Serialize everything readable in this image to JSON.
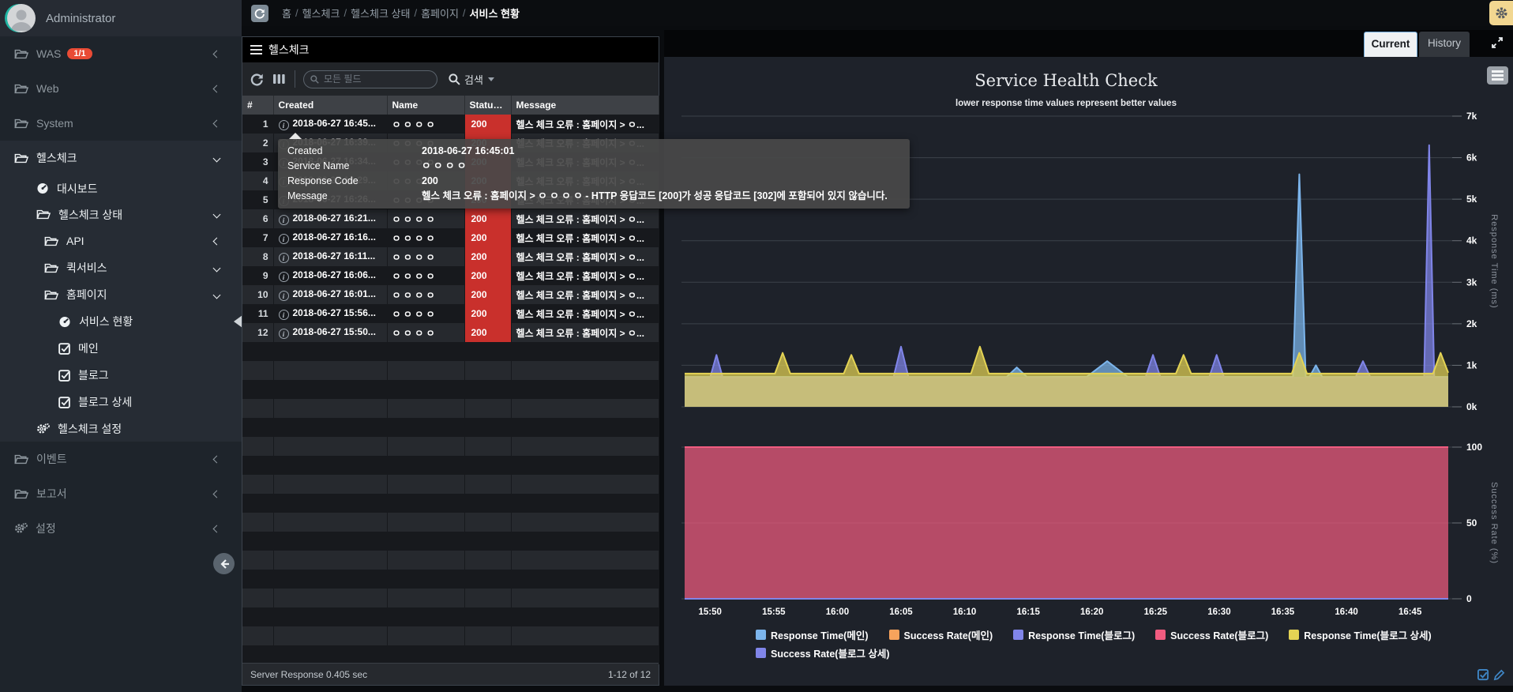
{
  "header": {
    "breadcrumb": {
      "items": [
        "홈",
        "헬스체크",
        "헬스체크 상태",
        "홈페이지"
      ],
      "current": "서비스 현황"
    }
  },
  "sidebar": {
    "user": {
      "name": "Administrator"
    },
    "items": [
      {
        "label": "WAS",
        "icon": "folder",
        "badge": "1/1",
        "chevron": "left",
        "level": 0,
        "bright": false
      },
      {
        "label": "Web",
        "icon": "folder",
        "chevron": "left",
        "level": 0,
        "bright": false
      },
      {
        "label": "System",
        "icon": "folder",
        "chevron": "left",
        "level": 0,
        "bright": false
      },
      {
        "label": "헬스체크",
        "icon": "folder",
        "chevron": "down",
        "level": 0,
        "bright": true,
        "section": true
      },
      {
        "label": "대시보드",
        "icon": "gauge",
        "level": 1,
        "bright": true,
        "section": true
      },
      {
        "label": "헬스체크 상태",
        "icon": "folder",
        "chevron": "down",
        "level": 1,
        "bright": true,
        "section": true
      },
      {
        "label": "API",
        "icon": "folder",
        "chevron": "left",
        "level": 2,
        "bright": true,
        "section": true
      },
      {
        "label": "퀵서비스",
        "icon": "folder",
        "chevron": "down",
        "level": 2,
        "bright": true,
        "section": true
      },
      {
        "label": "홈페이지",
        "icon": "folder",
        "chevron": "down",
        "level": 2,
        "bright": true,
        "section": true
      },
      {
        "label": "서비스 현황",
        "icon": "gauge",
        "level": 3,
        "bright": true,
        "section": true,
        "selected": true
      },
      {
        "label": "메인",
        "icon": "check",
        "level": 3,
        "bright": true,
        "section": true
      },
      {
        "label": "블로그",
        "icon": "check",
        "level": 3,
        "bright": true,
        "section": true
      },
      {
        "label": "블로그 상세",
        "icon": "check",
        "level": 3,
        "bright": true,
        "section": true
      },
      {
        "label": "헬스체크 설정",
        "icon": "gears",
        "level": 1,
        "bright": true,
        "section": true
      },
      {
        "label": "이벤트",
        "icon": "folder",
        "chevron": "left",
        "level": 0,
        "bright": false
      },
      {
        "label": "보고서",
        "icon": "folder",
        "chevron": "left",
        "level": 0,
        "bright": false
      },
      {
        "label": "설정",
        "icon": "gears",
        "chevron": "left",
        "level": 0,
        "bright": false
      }
    ]
  },
  "table_panel": {
    "title": "헬스체크",
    "toolbar": {
      "search_placeholder": "모든 필드",
      "search_label": "검색"
    },
    "columns": [
      "#",
      "Created",
      "Name",
      "Status...",
      "Message"
    ],
    "message_text": "헬스 체크 오류 : 홈페이지 > ㅇ...",
    "name_text": "ㅇ ㅇ ㅇ ㅇ",
    "status_code": "200",
    "created_list": [
      "2018-06-27 16:45...",
      "2018-06-27 16:39...",
      "2018-06-27 16:34...",
      "2018-06-27 16:29...",
      "2018-06-27 16:26...",
      "2018-06-27 16:21...",
      "2018-06-27 16:16...",
      "2018-06-27 16:11...",
      "2018-06-27 16:06...",
      "2018-06-27 16:01...",
      "2018-06-27 15:56...",
      "2018-06-27 15:50..."
    ],
    "footer": {
      "left": "Server Response 0.405 sec",
      "right": "1-12 of 12"
    }
  },
  "tooltip": {
    "rows": [
      [
        "Created",
        "2018-06-27 16:45:01"
      ],
      [
        "Service Name",
        "ㅇ ㅇ ㅇ ㅇ"
      ],
      [
        "Response Code",
        "200"
      ],
      [
        "Message",
        "헬스 체크 오류 : 홈페이지 > ㅇ ㅇ ㅇ ㅇ - HTTP 응답코드 [200]가 성공 응답코드 [302]에 포함되어 있지 않습니다."
      ]
    ]
  },
  "chart_panel": {
    "tabs": [
      "Current",
      "History"
    ],
    "active_tab": "Current"
  },
  "chart_data": [
    {
      "type": "area",
      "title": "Service Health Check",
      "subtitle": "lower response time values represent better values",
      "ylabel": "Response Time (ms)",
      "ylim": [
        0,
        7000
      ],
      "y_ticks": [
        "0k",
        "1k",
        "2k",
        "3k",
        "4k",
        "5k",
        "6k",
        "7k"
      ],
      "grid": true,
      "legend_position": "bottom",
      "x_range_minutes": [
        0,
        60
      ],
      "x_ticks": [
        {
          "t": 2,
          "label": "15:50"
        },
        {
          "t": 7,
          "label": "15:55"
        },
        {
          "t": 12,
          "label": "16:00"
        },
        {
          "t": 17,
          "label": "16:05"
        },
        {
          "t": 22,
          "label": "16:10"
        },
        {
          "t": 27,
          "label": "16:15"
        },
        {
          "t": 32,
          "label": "16:20"
        },
        {
          "t": 37,
          "label": "16:25"
        },
        {
          "t": 42,
          "label": "16:30"
        },
        {
          "t": 47,
          "label": "16:35"
        },
        {
          "t": 52,
          "label": "16:40"
        },
        {
          "t": 57,
          "label": "16:45"
        }
      ],
      "series": [
        {
          "name": "Response Time(메인)",
          "color": "#7cb5ec",
          "fill": true,
          "points": [
            [
              0,
              720
            ],
            [
              25.3,
              720
            ],
            [
              26.1,
              950
            ],
            [
              26.9,
              720
            ],
            [
              31.6,
              725
            ],
            [
              33.2,
              1100
            ],
            [
              34.8,
              725
            ],
            [
              47.8,
              720
            ],
            [
              48.3,
              5600
            ],
            [
              48.8,
              720
            ],
            [
              49.1,
              720
            ],
            [
              49.6,
              1000
            ],
            [
              50.1,
              720
            ],
            [
              60,
              720
            ]
          ]
        },
        {
          "name": "Response Time(블로그)",
          "color": "#8085e9",
          "fill": true,
          "points": [
            [
              0,
              700
            ],
            [
              2.0,
              700
            ],
            [
              2.5,
              1250
            ],
            [
              3.0,
              700
            ],
            [
              16.4,
              700
            ],
            [
              17.0,
              1450
            ],
            [
              17.6,
              700
            ],
            [
              36.2,
              700
            ],
            [
              36.8,
              1250
            ],
            [
              37.4,
              700
            ],
            [
              41.2,
              700
            ],
            [
              41.8,
              1250
            ],
            [
              42.4,
              700
            ],
            [
              52.7,
              700
            ],
            [
              53.3,
              1100
            ],
            [
              53.9,
              700
            ],
            [
              58.1,
              700
            ],
            [
              58.5,
              6300
            ],
            [
              58.9,
              700
            ],
            [
              60,
              700
            ]
          ]
        },
        {
          "name": "Response Time(블로그 상세)",
          "color": "#e4d354",
          "fill": true,
          "points": [
            [
              0,
              800
            ],
            [
              7.1,
              800
            ],
            [
              7.7,
              1300
            ],
            [
              8.3,
              800
            ],
            [
              12.5,
              800
            ],
            [
              13.1,
              1250
            ],
            [
              13.7,
              800
            ],
            [
              22.5,
              800
            ],
            [
              23.2,
              1450
            ],
            [
              23.9,
              800
            ],
            [
              38.6,
              800
            ],
            [
              39.2,
              1250
            ],
            [
              39.8,
              800
            ],
            [
              47.7,
              800
            ],
            [
              48.3,
              1300
            ],
            [
              48.9,
              800
            ],
            [
              58.8,
              800
            ],
            [
              59.4,
              1300
            ],
            [
              60,
              820
            ]
          ]
        }
      ]
    },
    {
      "type": "area",
      "ylabel": "Success Rate (%)",
      "ylim": [
        0,
        100
      ],
      "y_ticks": [
        "0",
        "50",
        "100"
      ],
      "grid": true,
      "x_range_minutes": [
        0,
        60
      ],
      "series": [
        {
          "name": "Success Rate(메인)",
          "color": "#f7a35c",
          "fill": false,
          "points": [
            [
              0,
              100
            ],
            [
              60,
              100
            ]
          ]
        },
        {
          "name": "Success Rate(블로그)",
          "color": "#f15c80",
          "fill": true,
          "points": [
            [
              0,
              100
            ],
            [
              60,
              100
            ]
          ]
        },
        {
          "name": "Success Rate(블로그 상세)",
          "color": "#8085e9",
          "fill": false,
          "points": [
            [
              0,
              0
            ],
            [
              60,
              0
            ]
          ]
        }
      ]
    }
  ],
  "legend": [
    {
      "label": "Response Time(메인)",
      "color": "#7cb5ec"
    },
    {
      "label": "Success Rate(메인)",
      "color": "#f7a35c"
    },
    {
      "label": "Response Time(블로그)",
      "color": "#8085e9"
    },
    {
      "label": "Success Rate(블로그)",
      "color": "#f15c80"
    },
    {
      "label": "Response Time(블로그 상세)",
      "color": "#e4d354"
    },
    {
      "label": "Success Rate(블로그 상세)",
      "color": "#8085e9"
    }
  ]
}
